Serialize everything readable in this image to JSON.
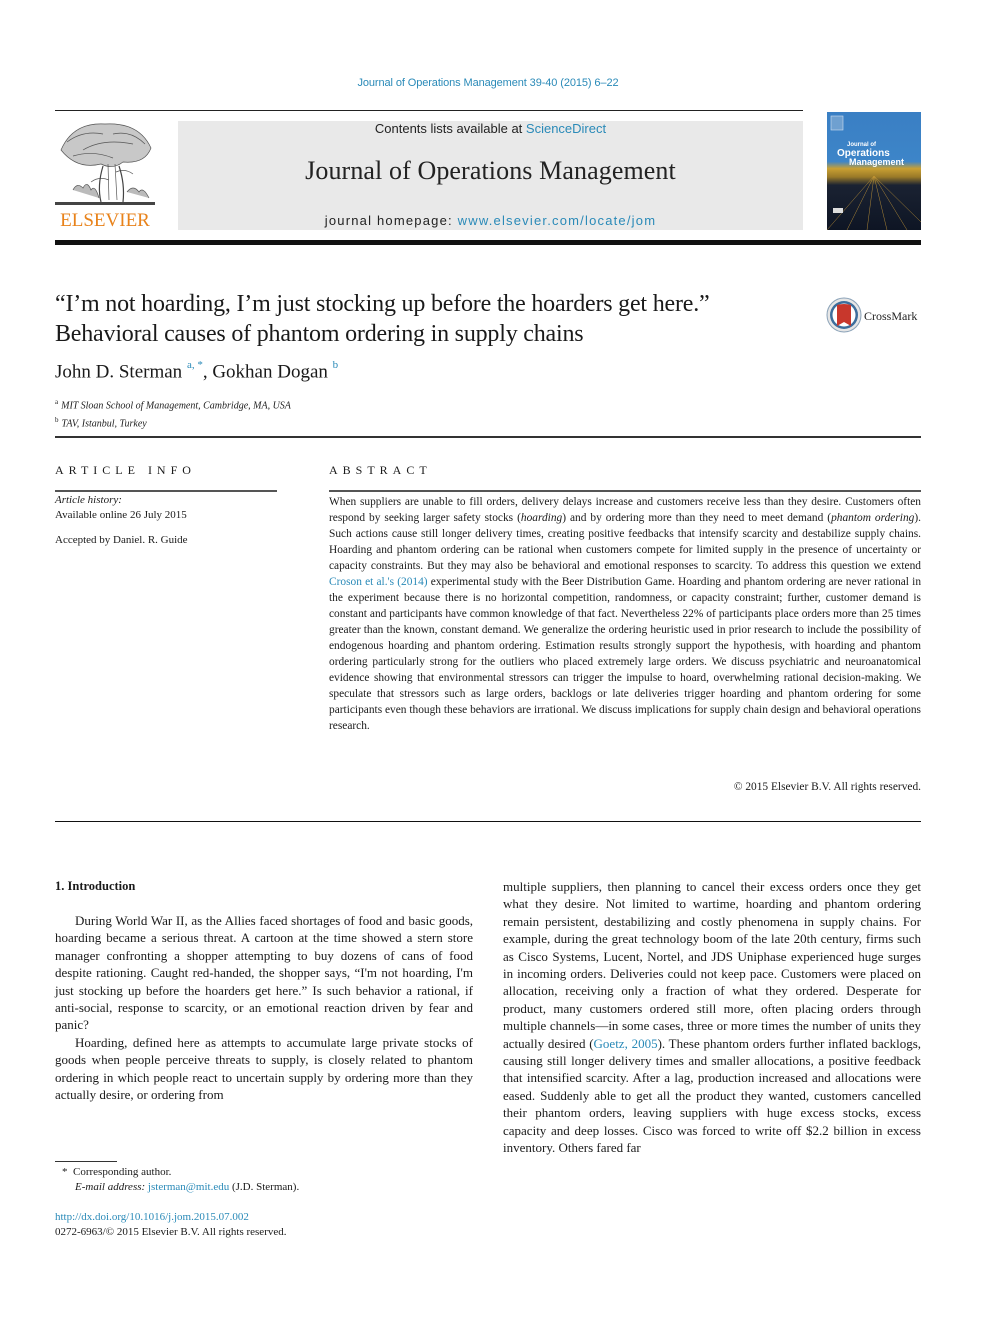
{
  "header": {
    "citation": "Journal of Operations Management 39-40 (2015) 6–22",
    "contents_prefix": "Contents lists available at ",
    "contents_link": "ScienceDirect",
    "journal_name": "Journal of Operations Management",
    "homepage_prefix": "journal homepage: ",
    "homepage_link": "www.elsevier.com/locate/jom",
    "publisher_logo_text": "ELSEVIER",
    "cover_title_line1": "Journal of",
    "cover_title_line2": "Operations",
    "cover_title_line3": "Management"
  },
  "article": {
    "title_line1": "“I’m not hoarding, I’m just stocking up before the hoarders get here.”",
    "title_line2": "Behavioral causes of phantom ordering in supply chains",
    "crossmark_label": "CrossMark",
    "authors": [
      {
        "name": "John D. Sterman",
        "marks": "a, *"
      },
      {
        "name": "Gokhan Dogan",
        "marks": "b"
      }
    ],
    "author_separator": ", ",
    "affiliations": [
      {
        "mark": "a",
        "text": "MIT Sloan School of Management, Cambridge, MA, USA"
      },
      {
        "mark": "b",
        "text": "TAV, Istanbul, Turkey"
      }
    ]
  },
  "article_info": {
    "heading": "ARTICLE INFO",
    "history_label": "Article history:",
    "history_value": "Available online 26 July 2015",
    "accepted": "Accepted by Daniel. R. Guide"
  },
  "abstract": {
    "heading": "ABSTRACT",
    "part1": "When suppliers are unable to fill orders, delivery delays increase and customers receive less than they desire. Customers often respond by seeking larger safety stocks (",
    "italic1": "hoarding",
    "part2": ") and by ordering more than they need to meet demand (",
    "italic2": "phantom ordering",
    "part3": "). Such actions cause still longer delivery times, creating positive feedbacks that intensify scarcity and destabilize supply chains. Hoarding and phantom ordering can be rational when customers compete for limited supply in the presence of uncertainty or capacity constraints. But they may also be behavioral and emotional responses to scarcity. To address this question we extend ",
    "citation_link": "Croson et al.'s (2014)",
    "part4": " experimental study with the Beer Distribution Game. Hoarding and phantom ordering are never rational in the experiment because there is no horizontal competition, randomness, or capacity constraint; further, customer demand is constant and participants have common knowledge of that fact. Nevertheless 22% of participants place orders more than 25 times greater than the known, constant demand. We generalize the ordering heuristic used in prior research to include the possibility of endogenous hoarding and phantom ordering. Estimation results strongly support the hypothesis, with hoarding and phantom ordering particularly strong for the outliers who placed extremely large orders. We discuss psychiatric and neuroanatomical evidence showing that environmental stressors can trigger the impulse to hoard, overwhelming rational decision-making. We speculate that stressors such as large orders, backlogs or late deliveries trigger hoarding and phantom ordering for some participants even though these behaviors are irrational. We discuss implications for supply chain design and behavioral operations research.",
    "copyright": "© 2015 Elsevier B.V. All rights reserved."
  },
  "body": {
    "section_heading": "1.  Introduction",
    "left_p1": "During World War II, as the Allies faced shortages of food and basic goods, hoarding became a serious threat. A cartoon at the time showed a stern store manager confronting a shopper attempting to buy dozens of cans of food despite rationing. Caught red-handed, the shopper says, “I'm not hoarding, I'm just stocking up before the hoarders get here.” Is such behavior a rational, if anti-social, response to scarcity, or an emotional reaction driven by fear and panic?",
    "left_p2": "Hoarding, defined here as attempts to accumulate large private stocks of goods when people perceive threats to supply, is closely related to phantom ordering in which people react to uncertain supply by ordering more than they actually desire, or ordering from",
    "right_p1_a": "multiple suppliers, then planning to cancel their excess orders once they get what they desire. Not limited to wartime, hoarding and phantom ordering remain persistent, destabilizing and costly phenomena in supply chains. For example, during the great technology boom of the late 20th century, firms such as Cisco Systems, Lucent, Nortel, and JDS Uniphase experienced huge surges in incoming orders. Deliveries could not keep pace. Customers were placed on allocation, receiving only a fraction of what they ordered. Desperate for product, many customers ordered still more, often placing orders through multiple channels—in some cases, three or more times the number of units they actually desired (",
    "right_citation": "Goetz, 2005",
    "right_p1_b": "). These phantom orders further inflated backlogs, causing still longer delivery times and smaller allocations, a positive feedback that intensified scarcity. After a lag, production increased and allocations were eased. Suddenly able to get all the product they wanted, customers cancelled their phantom orders, leaving suppliers with huge excess stocks, excess capacity and deep losses. Cisco was forced to write off $2.2 billion in excess inventory. Others fared far"
  },
  "footnotes": {
    "corresponding_mark": "*",
    "corresponding_text": "Corresponding author.",
    "email_label": "E-mail address:",
    "email": "jsterman@mit.edu",
    "email_owner": " (J.D. Sterman).",
    "doi": "http://dx.doi.org/10.1016/j.jom.2015.07.002",
    "issn": "0272-6963/© 2015 Elsevier B.V. All rights reserved."
  },
  "colors": {
    "link": "#2a8ab8",
    "elsevier_orange": "#e8821a",
    "banner_gray": "#e9e9e9"
  }
}
